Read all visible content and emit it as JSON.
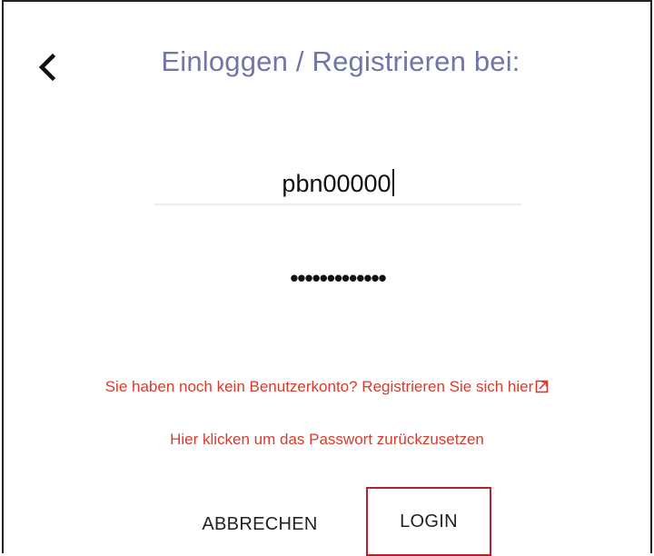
{
  "dialog": {
    "title": "Einloggen / Registrieren bei:"
  },
  "username": {
    "value": "pbn00000"
  },
  "password": {
    "masked_value": "•••••••••••••"
  },
  "links": {
    "register": "Sie haben noch kein Benutzerkonto? Registrieren Sie sich hier",
    "reset_password": "Hier klicken um das Passwort zurückzusetzen"
  },
  "buttons": {
    "cancel": "ABBRECHEN",
    "login": "LOGIN"
  },
  "colors": {
    "title": "#6f76a8",
    "link": "#d93a2e",
    "login_border": "#b8202a"
  },
  "icons": {
    "back": "chevron-left-icon",
    "external": "external-link-icon"
  }
}
